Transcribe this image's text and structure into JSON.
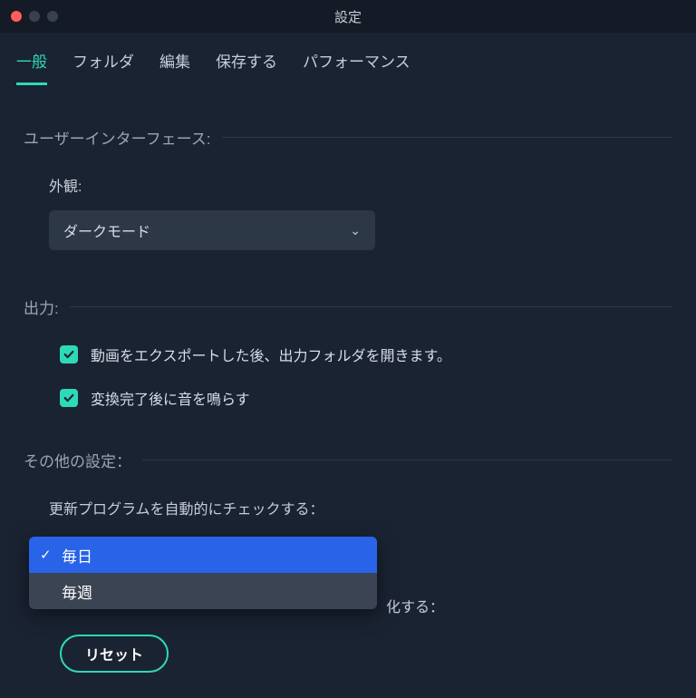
{
  "window": {
    "title": "設定"
  },
  "tabs": {
    "general": "一般",
    "folder": "フォルダ",
    "edit": "編集",
    "save": "保存する",
    "performance": "パフォーマンス"
  },
  "sections": {
    "ui": {
      "title": "ユーザーインターフェース:",
      "appearance_label": "外観:",
      "appearance_value": "ダークモード"
    },
    "output": {
      "title": "出力:",
      "open_folder": "動画をエクスポートした後、出力フォルダを開きます。",
      "play_sound": "変換完了後に音を鳴らす"
    },
    "other": {
      "title": "その他の設定：",
      "auto_update_label": "更新プログラムを自動的にチェックする：",
      "dropdown": {
        "daily": "毎日",
        "weekly": "毎週"
      },
      "partial_text": "化する：",
      "reset": "リセット"
    }
  },
  "icons": {
    "chevron_down": "⌄",
    "check": "✓"
  }
}
